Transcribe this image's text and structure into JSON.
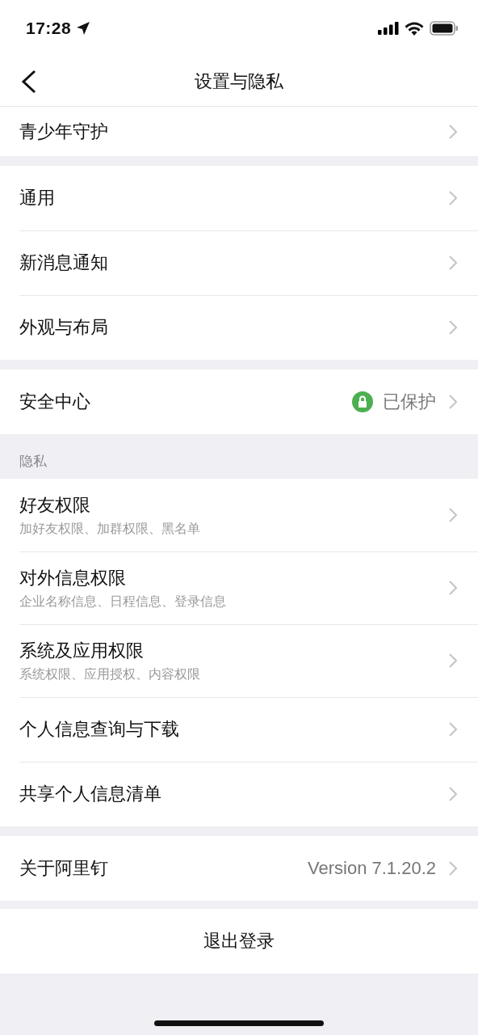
{
  "status_bar": {
    "time": "17:28"
  },
  "nav": {
    "title": "设置与隐私"
  },
  "groups": [
    {
      "rows": [
        {
          "title": "青少年守护",
          "cut": true
        }
      ]
    },
    {
      "rows": [
        {
          "title": "通用"
        },
        {
          "title": "新消息通知"
        },
        {
          "title": "外观与布局"
        }
      ]
    },
    {
      "rows": [
        {
          "title": "安全中心",
          "value": "已保护",
          "kind": "lock"
        }
      ]
    },
    {
      "header": "隐私",
      "rows": [
        {
          "title": "好友权限",
          "subtitle": "加好友权限、加群权限、黑名单"
        },
        {
          "title": "对外信息权限",
          "subtitle": "企业名称信息、日程信息、登录信息"
        },
        {
          "title": "系统及应用权限",
          "subtitle": "系统权限、应用授权、内容权限"
        },
        {
          "title": "个人信息查询与下载"
        },
        {
          "title": "共享个人信息清单"
        }
      ]
    },
    {
      "rows": [
        {
          "title": "关于阿里钉",
          "value": "Version 7.1.20.2"
        }
      ]
    }
  ],
  "logout": "退出登录"
}
